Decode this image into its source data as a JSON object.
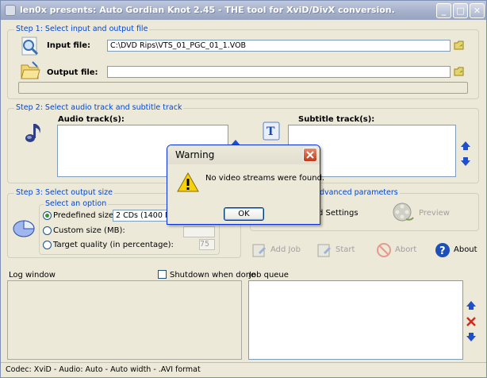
{
  "window": {
    "title": "len0x presents: Auto Gordian Knot 2.45 - THE tool for XviD/DivX conversion.",
    "controls": {
      "minimize": "_",
      "maximize": "□",
      "close": "✕"
    }
  },
  "step1": {
    "legend": "Step 1: Select input and output file",
    "input_label": "Input file:",
    "input_value": "C:\\DVD Rips\\VTS_01_PGC_01_1.VOB",
    "output_label": "Output file:",
    "output_value": ""
  },
  "step2": {
    "legend": "Step 2: Select audio track and subtitle track",
    "audio_label": "Audio track(s):",
    "subtitle_label": "Subtitle track(s):"
  },
  "step3": {
    "legend": "Step 3: Select output size",
    "option_legend": "Select an option",
    "options": [
      {
        "label": "Predefined size:",
        "selected": true
      },
      {
        "label": "Custom size (MB):",
        "selected": false
      },
      {
        "label": "Target quality (in percentage):",
        "selected": false
      }
    ],
    "predefined_value": "2 CDs (1400 MB)",
    "quality_value": "75"
  },
  "advanced": {
    "legend": "dvanced parameters",
    "settings_label": "d Settings",
    "preview_label": "Preview"
  },
  "actions": {
    "add_job": "Add Job",
    "start": "Start",
    "abort": "Abort",
    "about": "About"
  },
  "log": {
    "label": "Log window",
    "shutdown_label": "Shutdown when done",
    "job_queue_label": "Job queue"
  },
  "status": {
    "text": "Codec: XviD - Audio: Auto - Auto width - .AVI format"
  },
  "dialog": {
    "title": "Warning",
    "message": "No video streams were found.",
    "ok": "OK"
  },
  "colors": {
    "legend_blue": "#0046d5",
    "window_bg": "#ece9d8",
    "arrow_blue": "#1f4fc9",
    "delete_red": "#d12b1f"
  }
}
